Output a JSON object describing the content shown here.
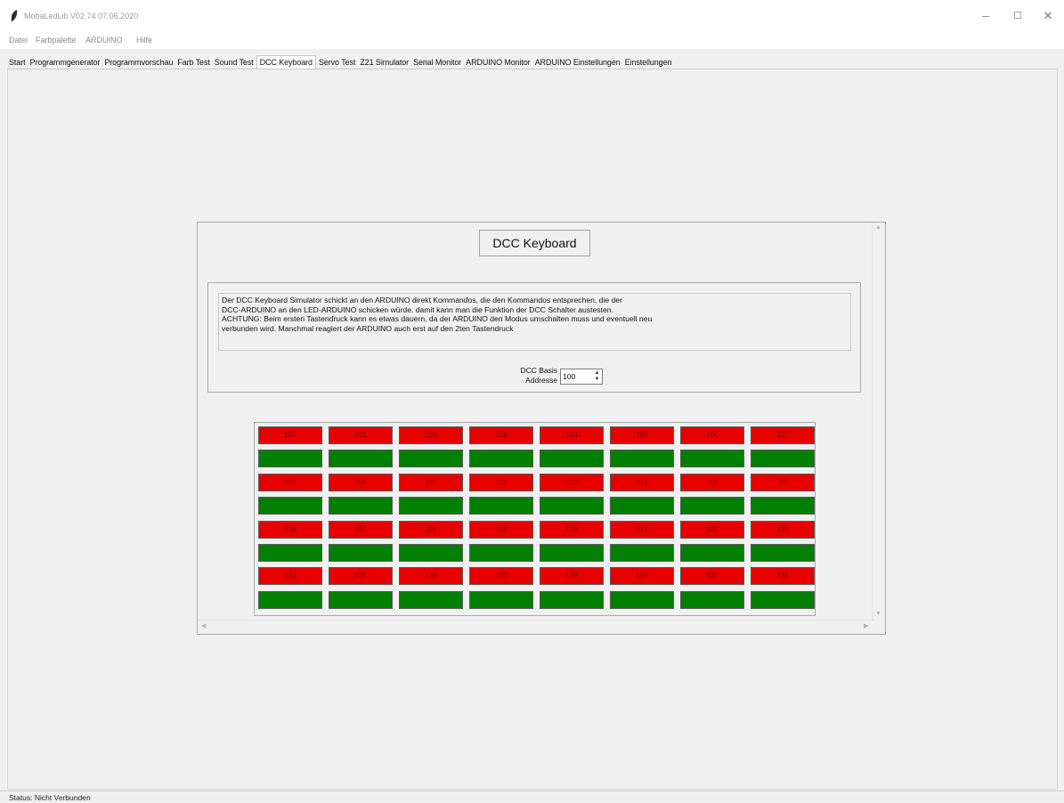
{
  "window": {
    "title": "MobaLedLib V02.74 07.06.2020",
    "controls": [
      "–",
      "☐",
      "✕"
    ]
  },
  "menu": [
    "Datei",
    "Farbpalette",
    "ARDUINO",
    "Hilfe"
  ],
  "tabs": [
    {
      "label": "Start",
      "active": false
    },
    {
      "label": "Programmgenerator",
      "active": false
    },
    {
      "label": "Programmvorschau",
      "active": false
    },
    {
      "label": "Farb Test",
      "active": false
    },
    {
      "label": "Sound Test",
      "active": false
    },
    {
      "label": "DCC Keyboard",
      "active": true
    },
    {
      "label": "Servo Test",
      "active": false
    },
    {
      "label": "Z21 Simulator",
      "active": false
    },
    {
      "label": "Serial Monitor",
      "active": false
    },
    {
      "label": "ARDUINO Monitor",
      "active": false
    },
    {
      "label": "ARDUINO Einstellungen",
      "active": false
    },
    {
      "label": "Einstellungen",
      "active": false
    }
  ],
  "dcc": {
    "title": "DCC Keyboard",
    "description": "Der DCC Keyboard Simulator schickt an den ARDUINO direkt Kommandos, die den Kommandos entsprechen, die der\nDCC-ARDUINO an den LED-ARDUINO schicken würde. damit kann man die Funktion der DCC Schalter austesten.\nACHTUNG: Beim ersten Tastendruck kann es etwas dauern, da der ARDUINO den Modus umschalten muss und eventuell neu\nverbunden wird. Manchmal reagiert der ARDUINO auch erst auf den 2ten Tastendruck",
    "basis_label_line1": "DCC Basis",
    "basis_label_line2": "Addresse",
    "basis_value": "100",
    "spin_up": "▲",
    "spin_down": "▼",
    "key_rows": [
      {
        "color": "red",
        "labels": [
          "100",
          "101",
          "102",
          "103",
          "104",
          "105",
          "106",
          "107"
        ]
      },
      {
        "color": "green",
        "labels": [
          "",
          "",
          "",
          "",
          "",
          "",
          "",
          ""
        ]
      },
      {
        "color": "red",
        "labels": [
          "108",
          "109",
          "110",
          "111",
          "112",
          "113",
          "114",
          "115"
        ]
      },
      {
        "color": "green",
        "labels": [
          "",
          "",
          "",
          "",
          "",
          "",
          "",
          ""
        ]
      },
      {
        "color": "red",
        "labels": [
          "116",
          "117",
          "118",
          "119",
          "120",
          "121",
          "122",
          "123"
        ]
      },
      {
        "color": "green",
        "labels": [
          "",
          "",
          "",
          "",
          "",
          "",
          "",
          ""
        ]
      },
      {
        "color": "red",
        "labels": [
          "124",
          "125",
          "126",
          "127",
          "128",
          "129",
          "130",
          "131"
        ]
      },
      {
        "color": "green",
        "labels": [
          "",
          "",
          "",
          "",
          "",
          "",
          "",
          ""
        ]
      }
    ]
  },
  "colors": {
    "key_red": "#e80000",
    "key_green": "#008000",
    "background": "#f0f0f0"
  },
  "status": "Status: Nicht Verbunden"
}
